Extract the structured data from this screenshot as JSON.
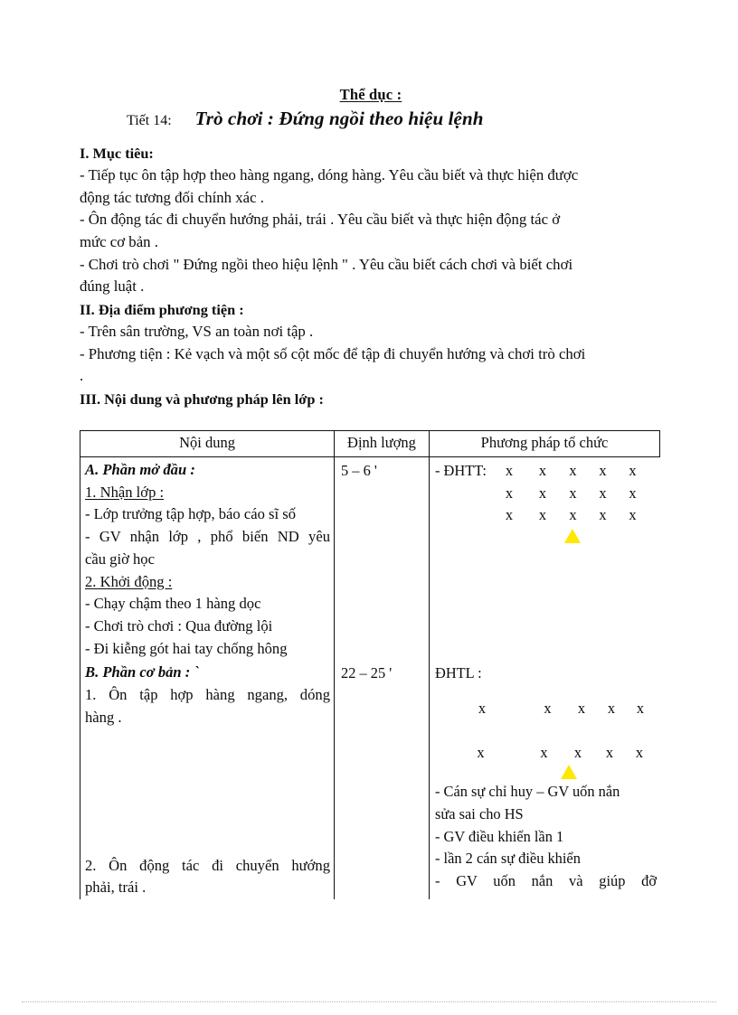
{
  "document": {
    "subject_heading": "Thể dục :",
    "lesson_number": "Tiết 14:",
    "lesson_title": "Trò chơi : Đứng ngồi theo hiệu lệnh"
  },
  "sections": {
    "objectives_heading": "I. Mục tiêu:",
    "objectives": [
      "- Tiếp tục ôn tập hợp theo hàng ngang, dóng hàng. Yêu cầu biết và thực hiện được động tác tương đối chính xác .",
      "- Ôn động tác đi chuyển hướng phải, trái . Yêu cầu biết và thực hiện động tác ở mức cơ bản .",
      "- Chơi trò chơi \" Đứng ngồi theo hiệu lệnh \" . Yêu cầu biết cách chơi và biết chơi đúng luật ."
    ],
    "objective_lines": [
      "- Tiếp tục ôn tập hợp theo hàng ngang, dóng hàng. Yêu cầu biết và thực hiện được",
      "động tác tương đối chính xác .",
      "- Ôn động tác đi chuyển hướng phải, trái . Yêu cầu biết và thực hiện động tác ở",
      "mức cơ bản .",
      "- Chơi trò chơi \" Đứng ngồi theo hiệu lệnh \" . Yêu cầu biết cách chơi và biết chơi",
      "đúng luật ."
    ],
    "venue_heading": "II. Địa điểm phương tiện :",
    "venue_lines": [
      "- Trên sân trường, VS an toàn nơi tập .",
      "- Phương tiện : Kẻ vạch và một số cột mốc để tập đi chuyển hướng và chơi trò chơi",
      "."
    ],
    "content_heading": "III. Nội dung và phương pháp lên lớp :"
  },
  "table": {
    "headers": [
      "Nội dung",
      "Định lượng",
      "Phương pháp tổ chức"
    ],
    "rows": [
      {
        "id": "part-a",
        "content_heading": "A. Phần mở đầu :",
        "content_lines": [
          {
            "text": "1. Nhận lớp :",
            "style": "sub"
          },
          {
            "text": "- Lớp trưởng tập hợp, báo cáo sĩ số",
            "style": "plain"
          },
          {
            "text": "- GV nhận lớp , phổ biến ND yêu",
            "style": "justify"
          },
          {
            "text": "cầu giờ học",
            "style": "plain"
          },
          {
            "text": "2. Khởi động :",
            "style": "sub"
          },
          {
            "text": "- Chạy chậm theo 1 hàng dọc",
            "style": "plain"
          },
          {
            "text": "- Chơi trò chơi : Qua đường lội",
            "style": "plain"
          },
          {
            "text": "- Đi kiễng gót hai tay chống hông",
            "style": "plain"
          }
        ],
        "quantity": "5 – 6 '",
        "method_label": "- ĐHTT:",
        "method_formation": {
          "mark": "x",
          "rows": 3,
          "cols": 5,
          "leader": "triangle"
        },
        "method_lines": []
      },
      {
        "id": "part-b",
        "content_heading": "B. Phần cơ bản : `",
        "content_lines": [
          {
            "text": "1. Ôn tập hợp hàng ngang, dóng",
            "style": "justify"
          },
          {
            "text": "hàng .",
            "style": "plain"
          },
          {
            "text": "2. Ôn động tác đi chuyển hướng",
            "style": "justify"
          },
          {
            "text": "phải, trái .",
            "style": "plain"
          }
        ],
        "quantity": "22 – 25 '",
        "method_label": "ĐHTL :",
        "method_formation": {
          "mark": "x",
          "rows": 2,
          "cols": 5,
          "leader": "triangle"
        },
        "method_lines": [
          {
            "text": "- Cán sự chỉ huy – GV uốn nắn",
            "style": "plain"
          },
          {
            "text": "sửa sai cho HS",
            "style": "plain"
          },
          {
            "text": "- GV điều khiển lần 1",
            "style": "plain"
          },
          {
            "text": "- lần 2 cán sự điều khiển",
            "style": "plain"
          },
          {
            "text": "- GV uốn nắn và giúp đỡ",
            "style": "justify"
          }
        ]
      }
    ]
  },
  "colors": {
    "page_background": "#ffffff",
    "text": "#0d0d0d",
    "table_border": "#111111",
    "leader_marker": "#ffe800"
  }
}
